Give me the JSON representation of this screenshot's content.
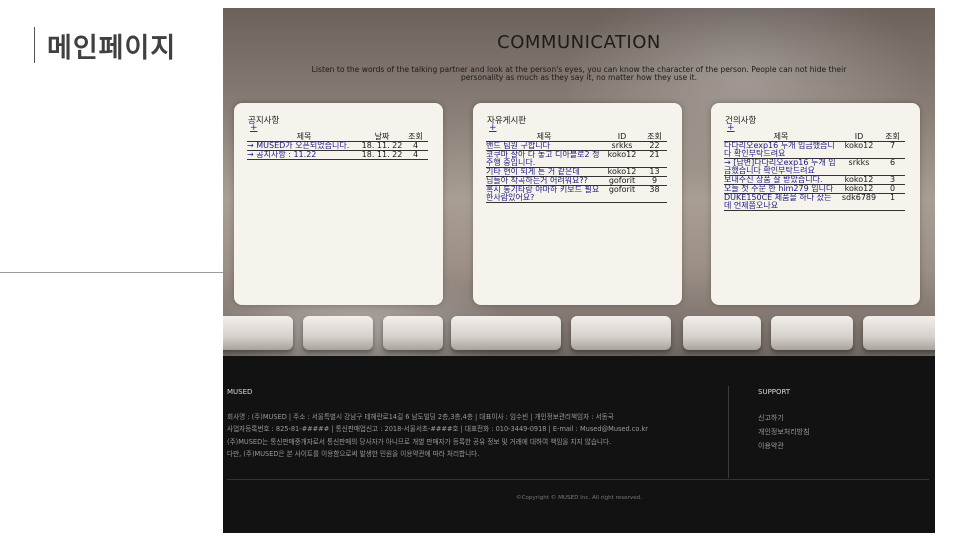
{
  "slide": {
    "title": "메인페이지"
  },
  "hero": {
    "title": "COMMUNICATION",
    "subtitle": "Listen to the words of the talking partner and look at the person's eyes, you can know the character of the person. People can not hide their personality as much as they say it, no matter how they use it."
  },
  "notice": {
    "title": "공지사항",
    "add": "+",
    "headers": [
      "제목",
      "날짜",
      "조회"
    ],
    "rows": [
      {
        "title": "→ MUSED가 오픈되었습니다.",
        "date": "18. 11. 22",
        "views": "4"
      },
      {
        "title": "→ 공지사항 : 11.22",
        "date": "18. 11. 22",
        "views": "4"
      }
    ]
  },
  "freeboard": {
    "title": "자유게시판",
    "add": "+",
    "headers": [
      "제목",
      "ID",
      "조회"
    ],
    "rows": [
      {
        "title": "밴드 팀원 구합니다",
        "id": "srkks",
        "views": "22"
      },
      {
        "title": "코쿠마 살아 다 놓고 디아블로2 정주행 중입니다.",
        "id": "koko12",
        "views": "21"
      },
      {
        "title": "기타 현이 되게 튼 거 같은데",
        "id": "koko12",
        "views": "13"
      },
      {
        "title": "님들아 작곡하는거 어려워요??",
        "id": "goforit",
        "views": "9"
      },
      {
        "title": "혹시 통기타랑 야마하 키보드 필요한사람있어요?",
        "id": "goforit",
        "views": "38"
      }
    ]
  },
  "suggest": {
    "title": "건의사항",
    "add": "+",
    "headers": [
      "제목",
      "ID",
      "조회"
    ],
    "rows": [
      {
        "title": "다다리오exp16 두개 입금했습니다 확인부탁드려요",
        "id": "koko12",
        "views": "7"
      },
      {
        "title": "→ [답변]다다리오exp16 두개 입금했습니다 확인부탁드려요",
        "id": "srkks",
        "views": "6"
      },
      {
        "title": "보내주신 상품 잘 받았습니다.",
        "id": "koko12",
        "views": "3"
      },
      {
        "title": "오늘 첫 주문 한 him279 입니다",
        "id": "koko12",
        "views": "0"
      },
      {
        "title": "DUKE150CE 제품을 하나 샀는데 언제쯤오나요",
        "id": "sdk6789",
        "views": "1"
      }
    ]
  },
  "footer": {
    "brand": "MUSED",
    "info": [
      "회사명 : (주)MUSED | 주소 : 서울특별시 강남구 테헤란로14길 6 남도빌딩 2층,3층,4층 | 대표이사 : 임수빈 | 개인정보관리책임자 : 서동국",
      "사업자등록번호 : 825-81-##### | 통신판매업신고 : 2018-서울서초-####호 | 대표전화 : 010-3449-0918 | E-mail : Mused@Mused.co.kr",
      "(주)MUSED는 통신판매중개자로서 통신판매의 당사자가 아니므로 개별 판매자가 등록한 공유 정보 및 거래에 대하여 책임을 지지 않습니다.",
      "다만, (주)MUSED은 본 사이트를 이용함으로써 발생한 민원을 이용약관에 따라 처리합니다."
    ],
    "support_title": "SUPPORT",
    "support_links": [
      "신고하기",
      "개인정보처리방침",
      "이용약관"
    ],
    "copyright": "©Copyright © MUSED Inc. All right reserved."
  }
}
